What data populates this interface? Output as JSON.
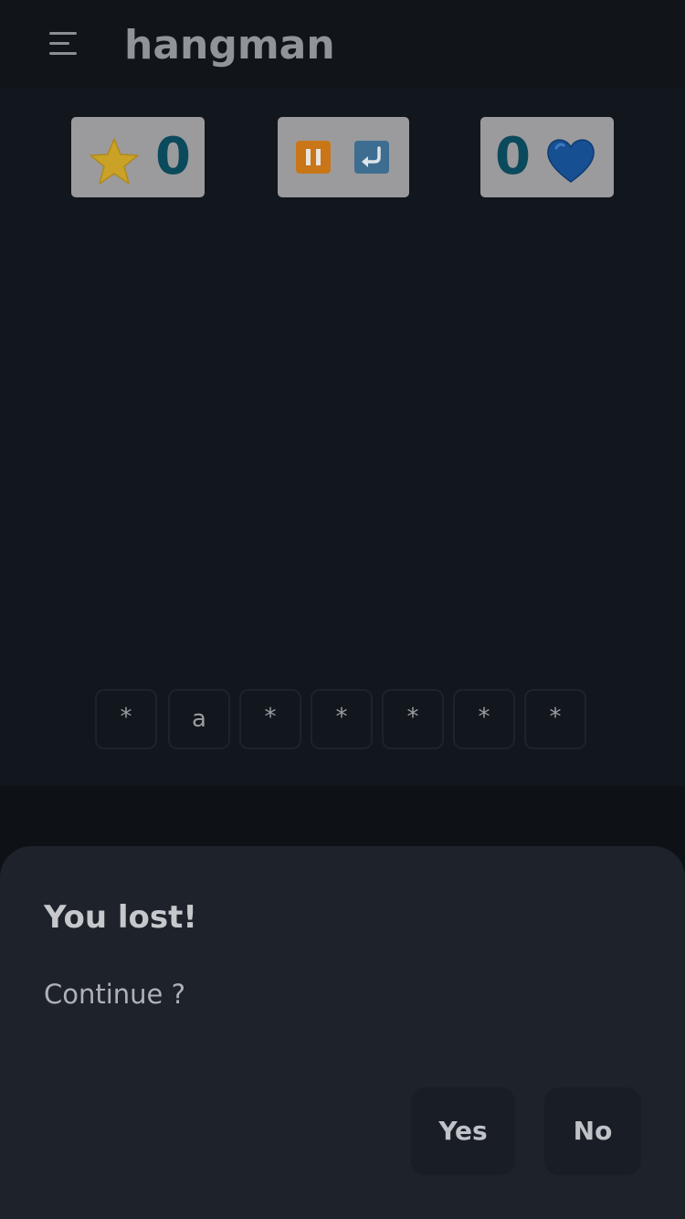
{
  "app": {
    "title": "hangman"
  },
  "stats": {
    "score": "0",
    "lives": "0",
    "icons": [
      "star-icon",
      "pause-icon",
      "undo-icon",
      "heart-icon"
    ],
    "colors": {
      "box": "#9b9b9d",
      "number": "#0b4a5c",
      "star": "#f2c22a",
      "heart": "#1b5fb3",
      "pause": "#e88a14",
      "undo": "#3d6d90"
    }
  },
  "word": {
    "letters": [
      "*",
      "a",
      "*",
      "*",
      "*",
      "*",
      "*"
    ]
  },
  "dialog": {
    "title": "You lost!",
    "message": "Continue ?",
    "yes_label": "Yes",
    "no_label": "No"
  }
}
